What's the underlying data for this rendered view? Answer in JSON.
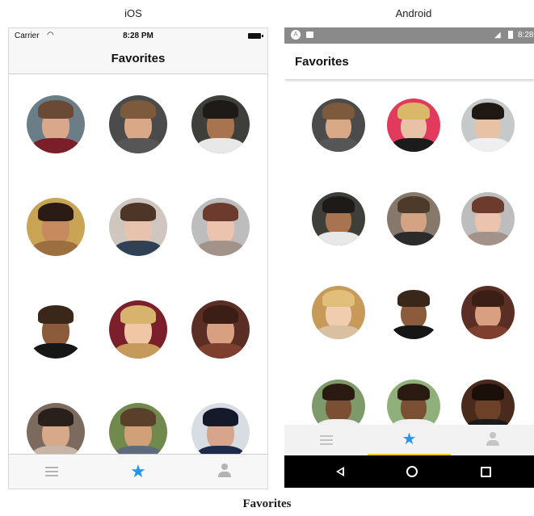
{
  "labels": {
    "ios": "iOS",
    "android": "Android",
    "caption": "Favorites"
  },
  "ios": {
    "status": {
      "carrier": "Carrier",
      "time": "8:28 PM"
    },
    "title": "Favorites",
    "tabs": [
      {
        "name": "list",
        "icon": "list-icon"
      },
      {
        "name": "favorites",
        "icon": "star-icon",
        "active": true
      },
      {
        "name": "profile",
        "icon": "person-icon"
      }
    ]
  },
  "android": {
    "status": {
      "time": "8:28"
    },
    "title": "Favorites",
    "tabs": [
      {
        "name": "list",
        "icon": "list-icon"
      },
      {
        "name": "favorites",
        "icon": "star-icon",
        "active": true
      },
      {
        "name": "profile",
        "icon": "person-icon"
      }
    ],
    "nav_buttons": [
      "back-icon",
      "home-icon",
      "recents-icon"
    ]
  },
  "colors": {
    "accent_blue": "#2196f3",
    "tab_indicator": "#f5c518"
  }
}
